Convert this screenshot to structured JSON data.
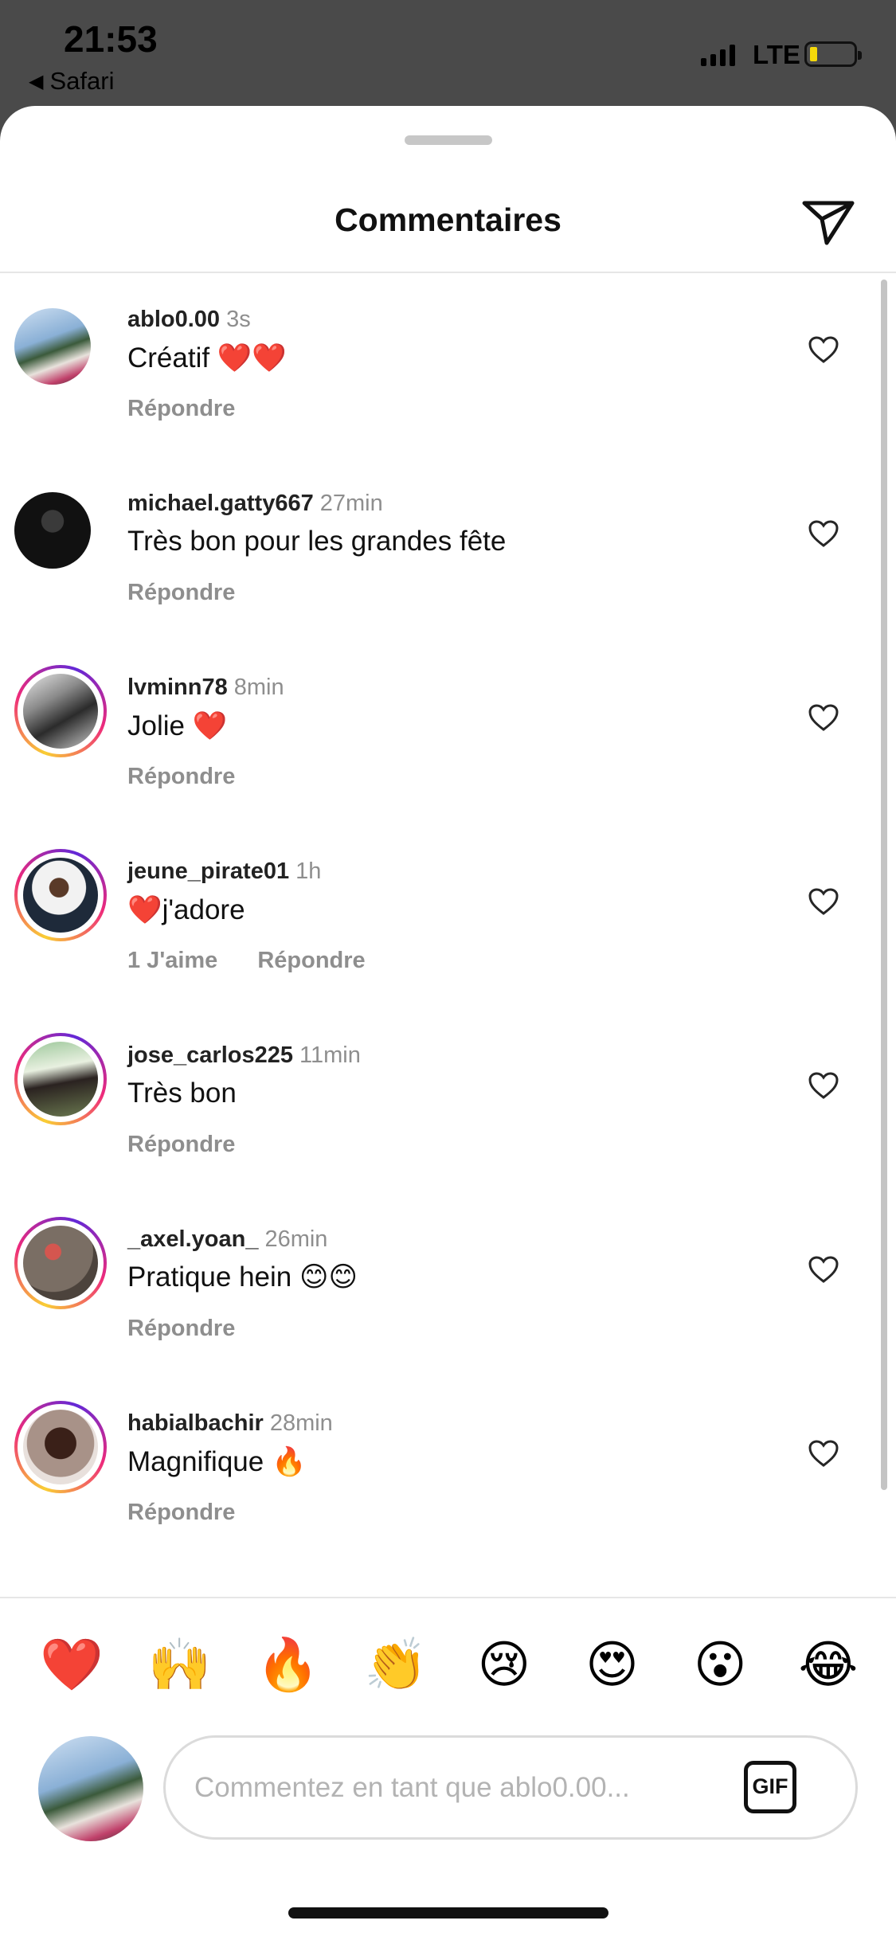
{
  "status_bar": {
    "time": "21:53",
    "back_app": "Safari",
    "network": "LTE",
    "back_glyph": "◀"
  },
  "sheet": {
    "title": "Commentaires",
    "share_icon": "paper-plane-icon"
  },
  "comments": [
    {
      "username": "ablo0.00",
      "time": "3s",
      "text": "Créatif ❤️❤️",
      "likes": "",
      "reply": "Répondre",
      "story_ring": false
    },
    {
      "username": "michael.gatty667",
      "time": "27min",
      "text": "Très bon pour les grandes fête",
      "likes": "",
      "reply": "Répondre",
      "story_ring": false
    },
    {
      "username": "lvminn78",
      "time": "8min",
      "text": "Jolie ❤️",
      "likes": "",
      "reply": "Répondre",
      "story_ring": true
    },
    {
      "username": "jeune_pirate01",
      "time": "1h",
      "text": "❤️j'adore",
      "likes": "1 J'aime",
      "reply": "Répondre",
      "story_ring": true
    },
    {
      "username": "jose_carlos225",
      "time": "11min",
      "text": "Très bon",
      "likes": "",
      "reply": "Répondre",
      "story_ring": true
    },
    {
      "username": "_axel.yoan_",
      "time": "26min",
      "text": "Pratique hein 😊😊",
      "likes": "",
      "reply": "Répondre",
      "story_ring": true
    },
    {
      "username": "habialbachir",
      "time": "28min",
      "text": "Magnifique 🔥",
      "likes": "",
      "reply": "Répondre",
      "story_ring": true
    }
  ],
  "emoji_bar": [
    "❤️",
    "🙌",
    "🔥",
    "👏",
    "😢",
    "😍",
    "😮",
    "😂"
  ],
  "composer": {
    "placeholder": "Commentez en tant que ablo0.00...",
    "gif_label": "GIF"
  }
}
